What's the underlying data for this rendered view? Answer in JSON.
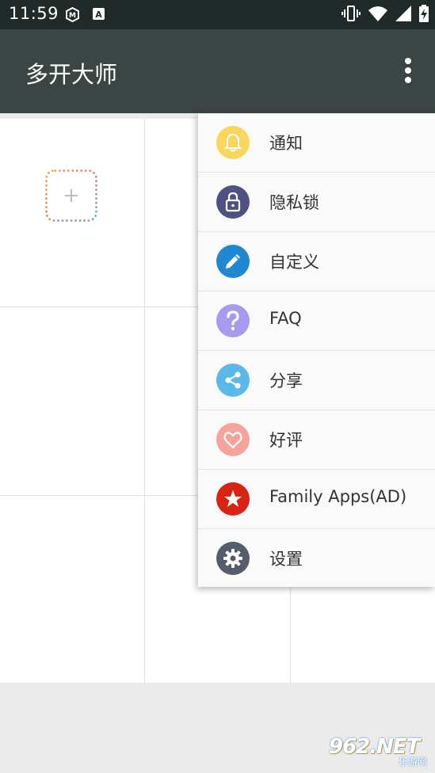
{
  "status_bar": {
    "time": "11:59",
    "notification_icons": [
      "m-badge-icon",
      "a-badge-icon"
    ],
    "system_icons": [
      "vibrate-icon",
      "wifi-icon",
      "signal-icon",
      "battery-charging-icon"
    ]
  },
  "app_bar": {
    "title": "多开大师",
    "overflow_icon": "more-vertical-icon"
  },
  "grid": {
    "add_icon": "plus-icon"
  },
  "menu": {
    "items": [
      {
        "label": "通知",
        "icon": "bell-icon",
        "color": "#f9d65c"
      },
      {
        "label": "隐私锁",
        "icon": "lock-icon",
        "color": "#4f5183"
      },
      {
        "label": "自定义",
        "icon": "pencil-icon",
        "color": "#1e88d2"
      },
      {
        "label": "FAQ",
        "icon": "question-icon",
        "color": "#a89af0"
      },
      {
        "label": "分享",
        "icon": "share-icon",
        "color": "#5ab9e9"
      },
      {
        "label": "好评",
        "icon": "heart-icon",
        "color": "#f7a29b"
      },
      {
        "label": "Family Apps(AD)",
        "icon": "star-icon",
        "color": "#d92414"
      },
      {
        "label": "设置",
        "icon": "gear-icon",
        "color": "#555d6b"
      }
    ]
  },
  "watermark": {
    "text": "962.NET",
    "sub": "乐游网"
  },
  "colors": {
    "status_bar": "#1f2a29",
    "app_bar": "#3b4544",
    "menu_bg": "#fafafa"
  }
}
